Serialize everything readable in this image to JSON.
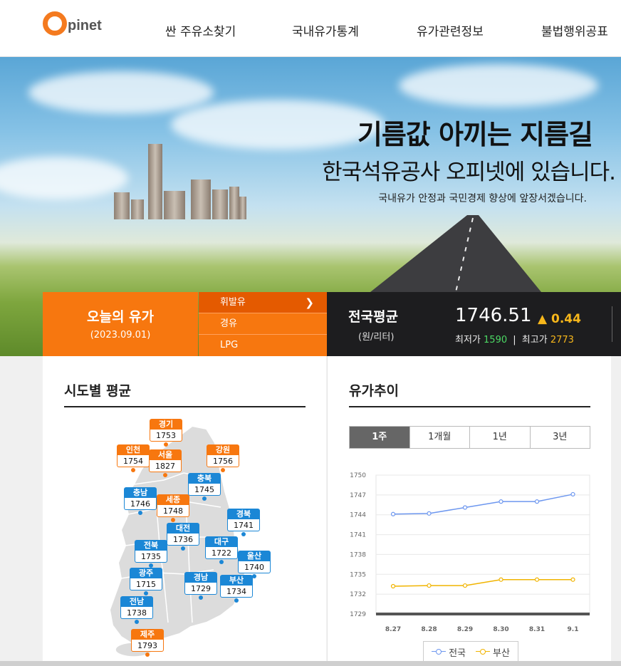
{
  "header": {
    "logo_letter": "O",
    "logo_text": "pinet",
    "nav": [
      "싼 주유소찾기",
      "국내유가통계",
      "유가관련정보",
      "불법행위공표"
    ]
  },
  "hero": {
    "title": "기름값 아끼는 지름길",
    "subtitle": "한국석유공사 오피넷에 있습니다.",
    "description": "국내유가 안정과 국민경제 향상에 앞장서겠습니다."
  },
  "price_bar": {
    "today_label": "오늘의 유가",
    "date": "(2023.09.01)",
    "fuel_tabs": [
      {
        "label": "휘발유",
        "active": true
      },
      {
        "label": "경유",
        "active": false
      },
      {
        "label": "LPG",
        "active": false
      }
    ],
    "national_label": "전국평균",
    "national_unit": "(원/리터)",
    "national_value": "1746.51",
    "change": "▲ 0.44",
    "min_label": "최저가",
    "min_value": "1590",
    "max_label": "최고가",
    "max_value": "2773",
    "separator": "|"
  },
  "region_panel": {
    "title": "시도별 평균",
    "regions": [
      {
        "name": "경기",
        "value": "1753",
        "color": "orange"
      },
      {
        "name": "인천",
        "value": "1754",
        "color": "orange"
      },
      {
        "name": "서울",
        "value": "1827",
        "color": "orange"
      },
      {
        "name": "강원",
        "value": "1756",
        "color": "orange"
      },
      {
        "name": "충북",
        "value": "1745",
        "color": "blue"
      },
      {
        "name": "충남",
        "value": "1746",
        "color": "blue"
      },
      {
        "name": "세종",
        "value": "1748",
        "color": "orange"
      },
      {
        "name": "경북",
        "value": "1741",
        "color": "blue"
      },
      {
        "name": "대전",
        "value": "1736",
        "color": "blue"
      },
      {
        "name": "전북",
        "value": "1735",
        "color": "blue"
      },
      {
        "name": "대구",
        "value": "1722",
        "color": "blue"
      },
      {
        "name": "울산",
        "value": "1740",
        "color": "blue"
      },
      {
        "name": "광주",
        "value": "1715",
        "color": "blue"
      },
      {
        "name": "경남",
        "value": "1729",
        "color": "blue"
      },
      {
        "name": "부산",
        "value": "1734",
        "color": "blue"
      },
      {
        "name": "전남",
        "value": "1738",
        "color": "blue"
      },
      {
        "name": "제주",
        "value": "1793",
        "color": "orange"
      }
    ]
  },
  "trend_panel": {
    "title": "유가추이",
    "tabs": [
      {
        "label": "1주",
        "active": true
      },
      {
        "label": "1개월",
        "active": false
      },
      {
        "label": "1년",
        "active": false
      },
      {
        "label": "3년",
        "active": false
      }
    ]
  },
  "chart_data": {
    "type": "line",
    "categories": [
      "8.27",
      "8.28",
      "8.29",
      "8.30",
      "8.31",
      "9.1"
    ],
    "series": [
      {
        "name": "전국",
        "color": "#6d97ef",
        "values": [
          1744.1,
          1744.2,
          1745.1,
          1746.0,
          1746.0,
          1747.1
        ]
      },
      {
        "name": "부산",
        "color": "#f1b400",
        "values": [
          1733.2,
          1733.3,
          1733.3,
          1734.2,
          1734.2,
          1734.2
        ]
      }
    ],
    "yticks": [
      "1750",
      "1747",
      "1744",
      "1741",
      "1738",
      "1735",
      "1732",
      "1729"
    ],
    "ylim": [
      1729,
      1750
    ],
    "grid": true,
    "legend": "bottom"
  }
}
